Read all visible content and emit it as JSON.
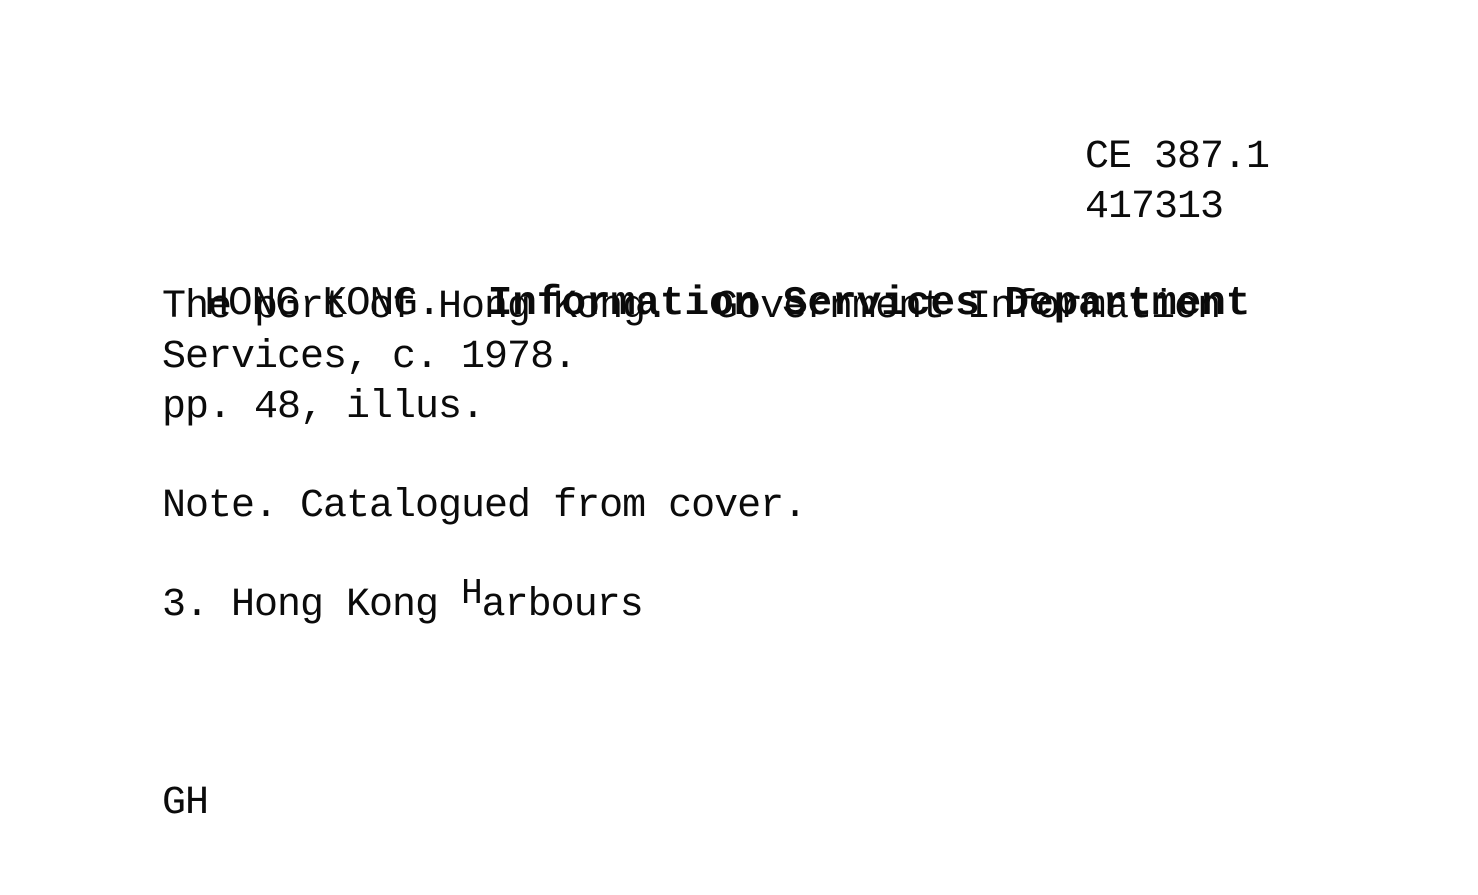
{
  "card": {
    "call_number": [
      "CE 387.1",
      "417313"
    ],
    "heading": {
      "main": "HONG KONG.",
      "sub": "Information Services Department"
    },
    "title_lines": [
      "The port of Hong Kong.  Government Information",
      "Services, c. 1978."
    ],
    "collation": "pp. 48, illus.",
    "note": "Note. Catalogued from cover.",
    "subject": {
      "prefix": "3. Hong Kong ",
      "superscript_letter": "H",
      "rest": "arbours"
    },
    "initials": "GH"
  }
}
